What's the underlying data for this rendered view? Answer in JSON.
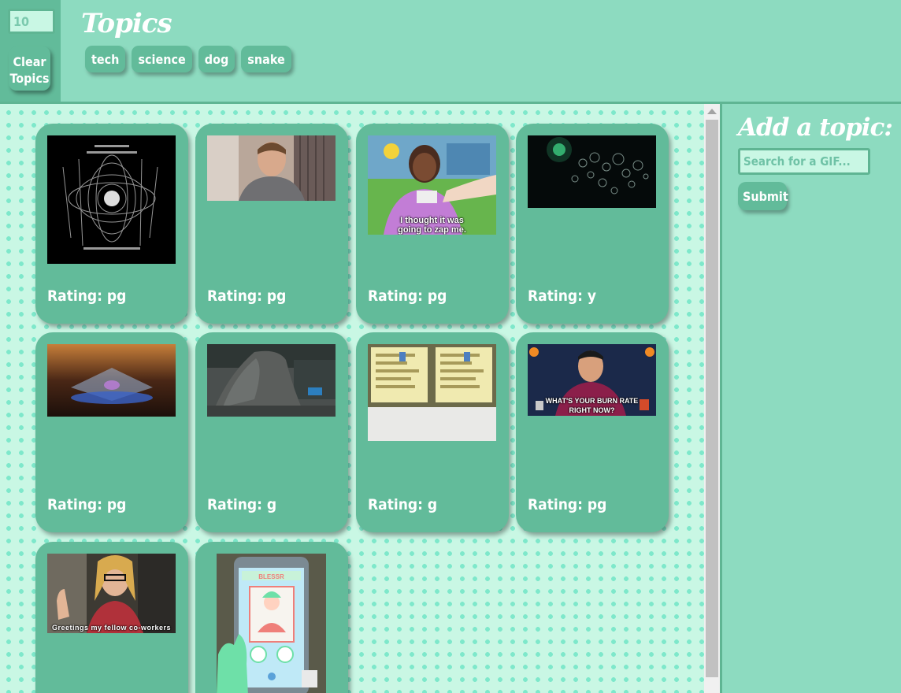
{
  "controls": {
    "limit_value": "10",
    "clear_label": "Clear\nTopics"
  },
  "header": {
    "title": "Topics",
    "topics": [
      "tech",
      "science",
      "dog",
      "snake"
    ]
  },
  "sidebar": {
    "title": "Add a topic:",
    "search_placeholder": "Search for a GIF...",
    "submit_label": "Submit"
  },
  "gifs": [
    {
      "rating_label": "Rating: pg",
      "caption": ""
    },
    {
      "rating_label": "Rating: pg",
      "caption": ""
    },
    {
      "rating_label": "Rating: pg",
      "caption": "I thought it was\ngoing to zap me."
    },
    {
      "rating_label": "Rating: y",
      "caption": ""
    },
    {
      "rating_label": "Rating: pg",
      "caption": ""
    },
    {
      "rating_label": "Rating: g",
      "caption": ""
    },
    {
      "rating_label": "Rating: g",
      "caption": ""
    },
    {
      "rating_label": "Rating: pg",
      "caption": "WHAT'S YOUR BURN RATE\nRIGHT NOW?"
    },
    {
      "rating_label": "",
      "caption": "Greetings my fellow co-workers"
    },
    {
      "rating_label": "",
      "caption": "BLESSR"
    }
  ],
  "colors": {
    "accent": "#62bb9a",
    "panel": "#8ddbc0",
    "field": "#c9f7e4",
    "dot": "#7ee8cb"
  }
}
